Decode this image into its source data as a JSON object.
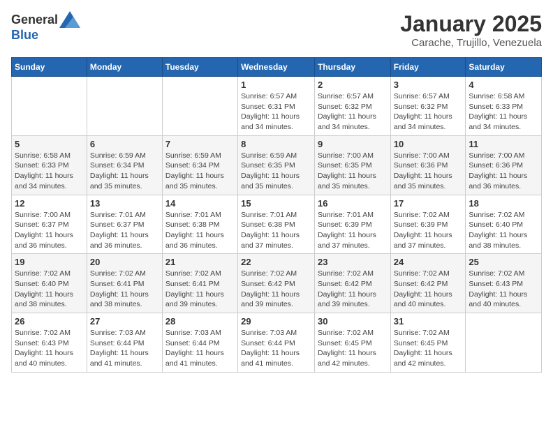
{
  "header": {
    "logo_general": "General",
    "logo_blue": "Blue",
    "month": "January 2025",
    "location": "Carache, Trujillo, Venezuela"
  },
  "weekdays": [
    "Sunday",
    "Monday",
    "Tuesday",
    "Wednesday",
    "Thursday",
    "Friday",
    "Saturday"
  ],
  "weeks": [
    [
      {
        "day": "",
        "sunrise": "",
        "sunset": "",
        "daylight": ""
      },
      {
        "day": "",
        "sunrise": "",
        "sunset": "",
        "daylight": ""
      },
      {
        "day": "",
        "sunrise": "",
        "sunset": "",
        "daylight": ""
      },
      {
        "day": "1",
        "sunrise": "Sunrise: 6:57 AM",
        "sunset": "Sunset: 6:31 PM",
        "daylight": "Daylight: 11 hours and 34 minutes."
      },
      {
        "day": "2",
        "sunrise": "Sunrise: 6:57 AM",
        "sunset": "Sunset: 6:32 PM",
        "daylight": "Daylight: 11 hours and 34 minutes."
      },
      {
        "day": "3",
        "sunrise": "Sunrise: 6:57 AM",
        "sunset": "Sunset: 6:32 PM",
        "daylight": "Daylight: 11 hours and 34 minutes."
      },
      {
        "day": "4",
        "sunrise": "Sunrise: 6:58 AM",
        "sunset": "Sunset: 6:33 PM",
        "daylight": "Daylight: 11 hours and 34 minutes."
      }
    ],
    [
      {
        "day": "5",
        "sunrise": "Sunrise: 6:58 AM",
        "sunset": "Sunset: 6:33 PM",
        "daylight": "Daylight: 11 hours and 34 minutes."
      },
      {
        "day": "6",
        "sunrise": "Sunrise: 6:59 AM",
        "sunset": "Sunset: 6:34 PM",
        "daylight": "Daylight: 11 hours and 35 minutes."
      },
      {
        "day": "7",
        "sunrise": "Sunrise: 6:59 AM",
        "sunset": "Sunset: 6:34 PM",
        "daylight": "Daylight: 11 hours and 35 minutes."
      },
      {
        "day": "8",
        "sunrise": "Sunrise: 6:59 AM",
        "sunset": "Sunset: 6:35 PM",
        "daylight": "Daylight: 11 hours and 35 minutes."
      },
      {
        "day": "9",
        "sunrise": "Sunrise: 7:00 AM",
        "sunset": "Sunset: 6:35 PM",
        "daylight": "Daylight: 11 hours and 35 minutes."
      },
      {
        "day": "10",
        "sunrise": "Sunrise: 7:00 AM",
        "sunset": "Sunset: 6:36 PM",
        "daylight": "Daylight: 11 hours and 35 minutes."
      },
      {
        "day": "11",
        "sunrise": "Sunrise: 7:00 AM",
        "sunset": "Sunset: 6:36 PM",
        "daylight": "Daylight: 11 hours and 36 minutes."
      }
    ],
    [
      {
        "day": "12",
        "sunrise": "Sunrise: 7:00 AM",
        "sunset": "Sunset: 6:37 PM",
        "daylight": "Daylight: 11 hours and 36 minutes."
      },
      {
        "day": "13",
        "sunrise": "Sunrise: 7:01 AM",
        "sunset": "Sunset: 6:37 PM",
        "daylight": "Daylight: 11 hours and 36 minutes."
      },
      {
        "day": "14",
        "sunrise": "Sunrise: 7:01 AM",
        "sunset": "Sunset: 6:38 PM",
        "daylight": "Daylight: 11 hours and 36 minutes."
      },
      {
        "day": "15",
        "sunrise": "Sunrise: 7:01 AM",
        "sunset": "Sunset: 6:38 PM",
        "daylight": "Daylight: 11 hours and 37 minutes."
      },
      {
        "day": "16",
        "sunrise": "Sunrise: 7:01 AM",
        "sunset": "Sunset: 6:39 PM",
        "daylight": "Daylight: 11 hours and 37 minutes."
      },
      {
        "day": "17",
        "sunrise": "Sunrise: 7:02 AM",
        "sunset": "Sunset: 6:39 PM",
        "daylight": "Daylight: 11 hours and 37 minutes."
      },
      {
        "day": "18",
        "sunrise": "Sunrise: 7:02 AM",
        "sunset": "Sunset: 6:40 PM",
        "daylight": "Daylight: 11 hours and 38 minutes."
      }
    ],
    [
      {
        "day": "19",
        "sunrise": "Sunrise: 7:02 AM",
        "sunset": "Sunset: 6:40 PM",
        "daylight": "Daylight: 11 hours and 38 minutes."
      },
      {
        "day": "20",
        "sunrise": "Sunrise: 7:02 AM",
        "sunset": "Sunset: 6:41 PM",
        "daylight": "Daylight: 11 hours and 38 minutes."
      },
      {
        "day": "21",
        "sunrise": "Sunrise: 7:02 AM",
        "sunset": "Sunset: 6:41 PM",
        "daylight": "Daylight: 11 hours and 39 minutes."
      },
      {
        "day": "22",
        "sunrise": "Sunrise: 7:02 AM",
        "sunset": "Sunset: 6:42 PM",
        "daylight": "Daylight: 11 hours and 39 minutes."
      },
      {
        "day": "23",
        "sunrise": "Sunrise: 7:02 AM",
        "sunset": "Sunset: 6:42 PM",
        "daylight": "Daylight: 11 hours and 39 minutes."
      },
      {
        "day": "24",
        "sunrise": "Sunrise: 7:02 AM",
        "sunset": "Sunset: 6:42 PM",
        "daylight": "Daylight: 11 hours and 40 minutes."
      },
      {
        "day": "25",
        "sunrise": "Sunrise: 7:02 AM",
        "sunset": "Sunset: 6:43 PM",
        "daylight": "Daylight: 11 hours and 40 minutes."
      }
    ],
    [
      {
        "day": "26",
        "sunrise": "Sunrise: 7:02 AM",
        "sunset": "Sunset: 6:43 PM",
        "daylight": "Daylight: 11 hours and 40 minutes."
      },
      {
        "day": "27",
        "sunrise": "Sunrise: 7:03 AM",
        "sunset": "Sunset: 6:44 PM",
        "daylight": "Daylight: 11 hours and 41 minutes."
      },
      {
        "day": "28",
        "sunrise": "Sunrise: 7:03 AM",
        "sunset": "Sunset: 6:44 PM",
        "daylight": "Daylight: 11 hours and 41 minutes."
      },
      {
        "day": "29",
        "sunrise": "Sunrise: 7:03 AM",
        "sunset": "Sunset: 6:44 PM",
        "daylight": "Daylight: 11 hours and 41 minutes."
      },
      {
        "day": "30",
        "sunrise": "Sunrise: 7:02 AM",
        "sunset": "Sunset: 6:45 PM",
        "daylight": "Daylight: 11 hours and 42 minutes."
      },
      {
        "day": "31",
        "sunrise": "Sunrise: 7:02 AM",
        "sunset": "Sunset: 6:45 PM",
        "daylight": "Daylight: 11 hours and 42 minutes."
      },
      {
        "day": "",
        "sunrise": "",
        "sunset": "",
        "daylight": ""
      }
    ]
  ]
}
